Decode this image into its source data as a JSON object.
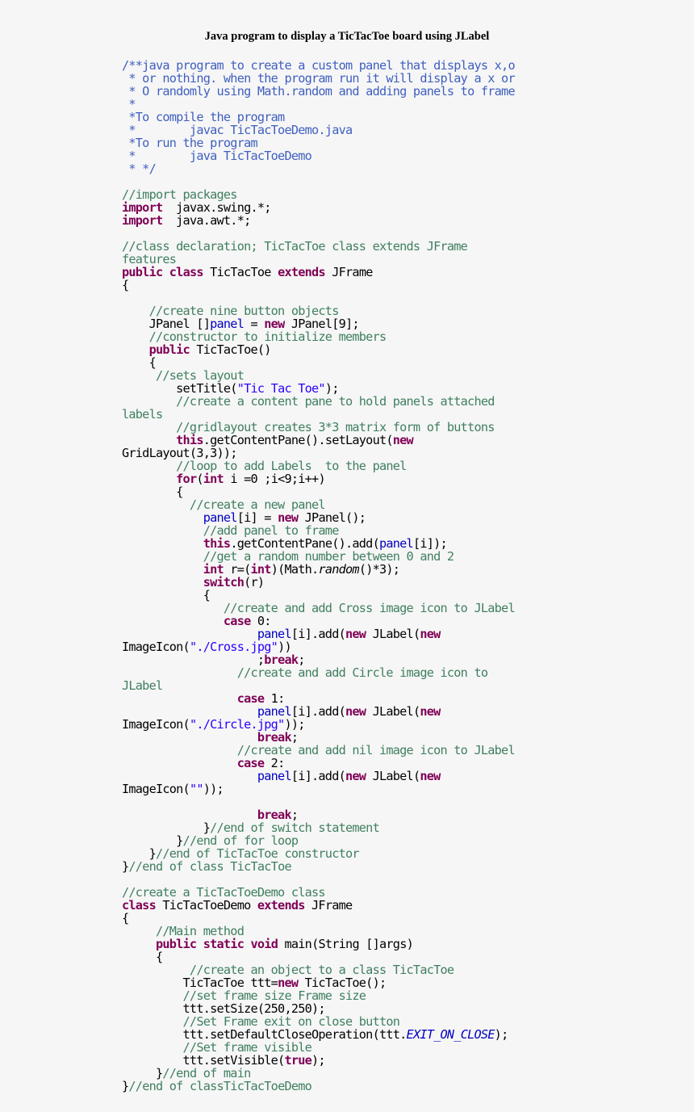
{
  "document": {
    "title": "Java program to display a TicTacToe board using JLabel",
    "language": "java",
    "code_lines": [
      [
        [
          "jd",
          "/**java program to create a custom panel that displays x,o"
        ]
      ],
      [
        [
          "jd",
          " * or nothing. when the program run it will display a x or"
        ]
      ],
      [
        [
          "jd",
          " * O randomly using Math.random and adding panels to frame"
        ]
      ],
      [
        [
          "jd",
          " *"
        ]
      ],
      [
        [
          "jd",
          " *To compile the program"
        ]
      ],
      [
        [
          "jd",
          " *        javac TicTacToeDemo.java"
        ]
      ],
      [
        [
          "jd",
          " *To run the program"
        ]
      ],
      [
        [
          "jd",
          " *        java TicTacToeDemo"
        ]
      ],
      [
        [
          "jd",
          " * */"
        ]
      ],
      [],
      [
        [
          "cm",
          "//import packages"
        ]
      ],
      [
        [
          "kw",
          "import"
        ],
        [
          "",
          "  javax.swing.*;"
        ]
      ],
      [
        [
          "kw",
          "import"
        ],
        [
          "",
          "  java.awt.*;"
        ]
      ],
      [],
      [
        [
          "cm",
          "//class declaration; TicTacToe class extends JFrame"
        ]
      ],
      [
        [
          "cm",
          "features"
        ]
      ],
      [
        [
          "kw",
          "public"
        ],
        [
          "",
          " "
        ],
        [
          "kw",
          "class"
        ],
        [
          "",
          " TicTacToe "
        ],
        [
          "kw",
          "extends"
        ],
        [
          "",
          " JFrame"
        ]
      ],
      [
        [
          "",
          "{"
        ]
      ],
      [],
      [
        [
          "cm",
          "    //create nine button objects"
        ]
      ],
      [
        [
          "",
          "    JPanel []"
        ],
        [
          "fd",
          "panel"
        ],
        [
          "",
          " = "
        ],
        [
          "kw",
          "new"
        ],
        [
          "",
          " JPanel[9];"
        ]
      ],
      [
        [
          "cm",
          "    //constructor to initialize members"
        ]
      ],
      [
        [
          "",
          "    "
        ],
        [
          "kw",
          "public"
        ],
        [
          "",
          " TicTacToe()"
        ]
      ],
      [
        [
          "",
          "    {"
        ]
      ],
      [
        [
          "cm",
          "     //sets layout"
        ]
      ],
      [
        [
          "",
          "        setTitle("
        ],
        [
          "st",
          "\"Tic Tac Toe\""
        ],
        [
          "",
          ");"
        ]
      ],
      [
        [
          "cm",
          "        //create a content pane to hold panels attached"
        ]
      ],
      [
        [
          "cm",
          "labels"
        ]
      ],
      [
        [
          "cm",
          "        //gridlayout creates 3*3 matrix form of buttons"
        ]
      ],
      [
        [
          "",
          "        "
        ],
        [
          "kw",
          "this"
        ],
        [
          "",
          ".getContentPane().setLayout("
        ],
        [
          "kw",
          "new"
        ]
      ],
      [
        [
          "",
          "GridLayout(3,3));"
        ]
      ],
      [
        [
          "cm",
          "        //loop to add Labels  to the panel"
        ]
      ],
      [
        [
          "",
          "        "
        ],
        [
          "kw",
          "for"
        ],
        [
          "",
          "("
        ],
        [
          "kw",
          "int"
        ],
        [
          "",
          " i =0 ;i<9;i++)"
        ]
      ],
      [
        [
          "",
          "        {"
        ]
      ],
      [
        [
          "cm",
          "          //create a new panel"
        ]
      ],
      [
        [
          "",
          "            "
        ],
        [
          "fd",
          "panel"
        ],
        [
          "",
          "[i] = "
        ],
        [
          "kw",
          "new"
        ],
        [
          "",
          " JPanel();"
        ]
      ],
      [
        [
          "cm",
          "            //add panel to frame"
        ]
      ],
      [
        [
          "",
          "            "
        ],
        [
          "kw",
          "this"
        ],
        [
          "",
          ".getContentPane().add("
        ],
        [
          "fd",
          "panel"
        ],
        [
          "",
          "[i]);"
        ]
      ],
      [
        [
          "cm",
          "            //get a random number between 0 and 2"
        ]
      ],
      [
        [
          "",
          "            "
        ],
        [
          "kw",
          "int"
        ],
        [
          "",
          " r=("
        ],
        [
          "kw",
          "int"
        ],
        [
          "",
          ")(Math."
        ],
        [
          "it",
          "random"
        ],
        [
          "",
          "()*3);"
        ]
      ],
      [
        [
          "",
          "            "
        ],
        [
          "kw",
          "switch"
        ],
        [
          "",
          "(r)"
        ]
      ],
      [
        [
          "",
          "            {"
        ]
      ],
      [
        [
          "cm",
          "               //create and add Cross image icon to JLabel"
        ]
      ],
      [
        [
          "",
          "               "
        ],
        [
          "kw",
          "case"
        ],
        [
          "",
          " 0:"
        ]
      ],
      [
        [
          "",
          "                    "
        ],
        [
          "fd",
          "panel"
        ],
        [
          "",
          "[i].add("
        ],
        [
          "kw",
          "new"
        ],
        [
          "",
          " JLabel("
        ],
        [
          "kw",
          "new"
        ]
      ],
      [
        [
          "",
          "ImageIcon("
        ],
        [
          "st",
          "\"./Cross.jpg\""
        ],
        [
          "",
          "))"
        ]
      ],
      [
        [
          "",
          "                    ;"
        ],
        [
          "kw",
          "break"
        ],
        [
          "",
          ";"
        ]
      ],
      [
        [
          "cm",
          "                 //create and add Circle image icon to"
        ]
      ],
      [
        [
          "cm",
          "JLabel"
        ]
      ],
      [
        [
          "",
          "                 "
        ],
        [
          "kw",
          "case"
        ],
        [
          "",
          " 1:"
        ]
      ],
      [
        [
          "",
          "                    "
        ],
        [
          "fd",
          "panel"
        ],
        [
          "",
          "[i].add("
        ],
        [
          "kw",
          "new"
        ],
        [
          "",
          " JLabel("
        ],
        [
          "kw",
          "new"
        ]
      ],
      [
        [
          "",
          "ImageIcon("
        ],
        [
          "st",
          "\"./Circle.jpg\""
        ],
        [
          "",
          "));"
        ]
      ],
      [
        [
          "",
          "                    "
        ],
        [
          "kw",
          "break"
        ],
        [
          "",
          ";"
        ]
      ],
      [
        [
          "cm",
          "                 //create and add nil image icon to JLabel"
        ]
      ],
      [
        [
          "",
          "                 "
        ],
        [
          "kw",
          "case"
        ],
        [
          "",
          " 2:"
        ]
      ],
      [
        [
          "",
          "                    "
        ],
        [
          "fd",
          "panel"
        ],
        [
          "",
          "[i].add("
        ],
        [
          "kw",
          "new"
        ],
        [
          "",
          " JLabel("
        ],
        [
          "kw",
          "new"
        ]
      ],
      [
        [
          "",
          "ImageIcon("
        ],
        [
          "st",
          "\"\""
        ],
        [
          "",
          "));"
        ]
      ],
      [],
      [
        [
          "",
          "                    "
        ],
        [
          "kw",
          "break"
        ],
        [
          "",
          ";"
        ]
      ],
      [
        [
          "",
          "            }"
        ],
        [
          "cm",
          "//end of switch statement"
        ]
      ],
      [
        [
          "",
          "        }"
        ],
        [
          "cm",
          "//end of for loop"
        ]
      ],
      [
        [
          "",
          "    }"
        ],
        [
          "cm",
          "//end of TicTacToe constructor"
        ]
      ],
      [
        [
          "",
          "}"
        ],
        [
          "cm",
          "//end of class TicTacToe"
        ]
      ],
      [],
      [
        [
          "cm",
          "//create a TicTacToeDemo class"
        ]
      ],
      [
        [
          "kw",
          "class"
        ],
        [
          "",
          " TicTacToeDemo "
        ],
        [
          "kw",
          "extends"
        ],
        [
          "",
          " JFrame"
        ]
      ],
      [
        [
          "",
          "{"
        ]
      ],
      [
        [
          "cm",
          "     //Main method"
        ]
      ],
      [
        [
          "",
          "     "
        ],
        [
          "kw",
          "public"
        ],
        [
          "",
          " "
        ],
        [
          "kw",
          "static"
        ],
        [
          "",
          " "
        ],
        [
          "kw",
          "void"
        ],
        [
          "",
          " main(String []args)"
        ]
      ],
      [
        [
          "",
          "     {"
        ]
      ],
      [
        [
          "cm",
          "          //create an object to a class TicTacToe"
        ]
      ],
      [
        [
          "",
          "         TicTacToe ttt="
        ],
        [
          "kw",
          "new"
        ],
        [
          "",
          " TicTacToe();"
        ]
      ],
      [
        [
          "cm",
          "         //set frame size Frame size"
        ]
      ],
      [
        [
          "",
          "         ttt.setSize(250,250);"
        ]
      ],
      [
        [
          "cm",
          "         //Set Frame exit on close button"
        ]
      ],
      [
        [
          "",
          "         ttt.setDefaultCloseOperation(ttt."
        ],
        [
          "sf",
          "EXIT_ON_CLOSE"
        ],
        [
          "",
          ");"
        ]
      ],
      [
        [
          "cm",
          "         //Set frame visible"
        ]
      ],
      [
        [
          "",
          "         ttt.setVisible("
        ],
        [
          "kw",
          "true"
        ],
        [
          "",
          ");"
        ]
      ],
      [
        [
          "",
          "     }"
        ],
        [
          "cm",
          "//end of main"
        ]
      ],
      [
        [
          "",
          "}"
        ],
        [
          "cm",
          "//end of classTicTacToeDemo"
        ]
      ]
    ]
  }
}
